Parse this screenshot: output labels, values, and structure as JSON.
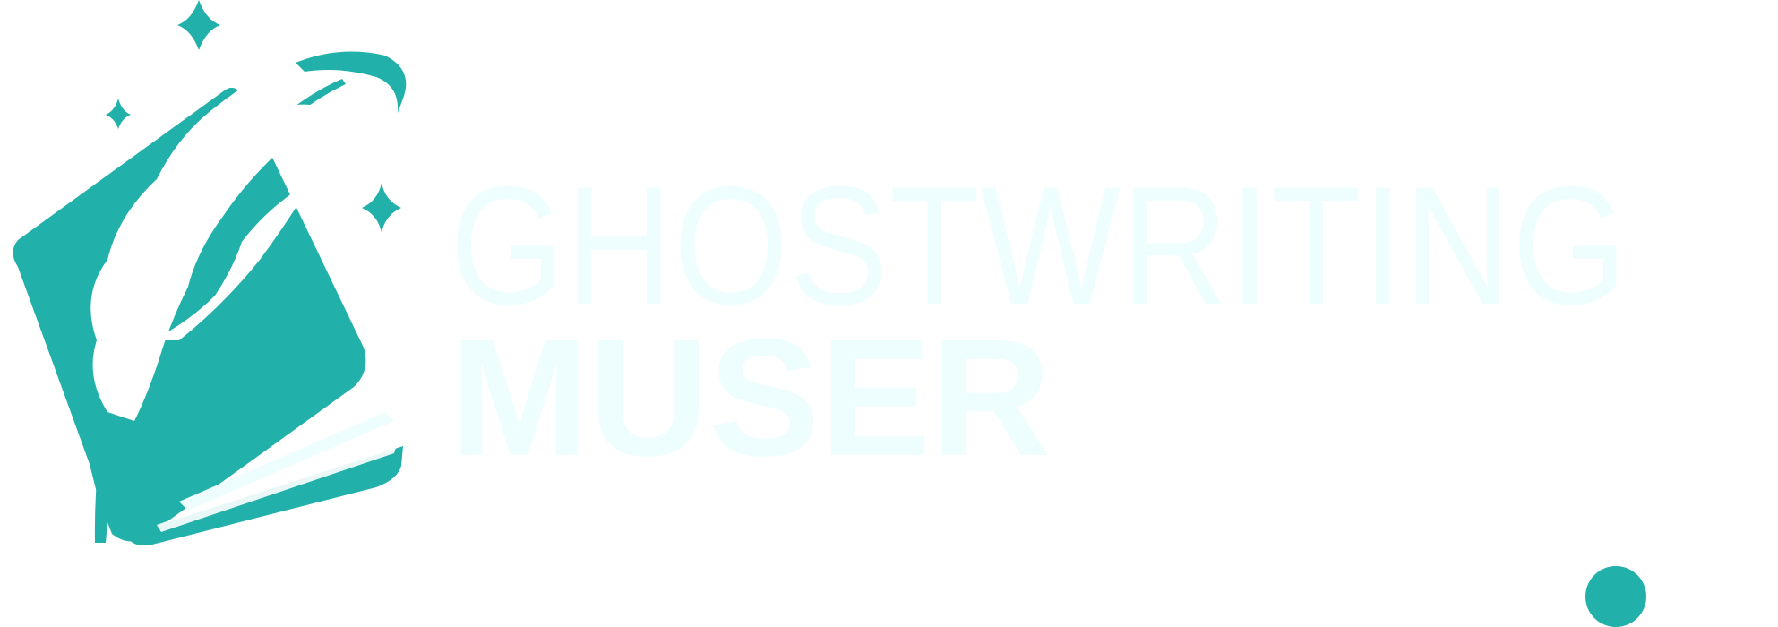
{
  "brand": {
    "line1": "GHOSTWRITING",
    "line2": "MUSER"
  },
  "colors": {
    "accent": "#22b1aa",
    "wordmark": "#eefdfd",
    "feather": "#ffffff",
    "background": "#ffffff"
  },
  "icons": {
    "book": "book-icon",
    "feather": "feather-quill-icon",
    "sparkles": "sparkle-icon"
  }
}
